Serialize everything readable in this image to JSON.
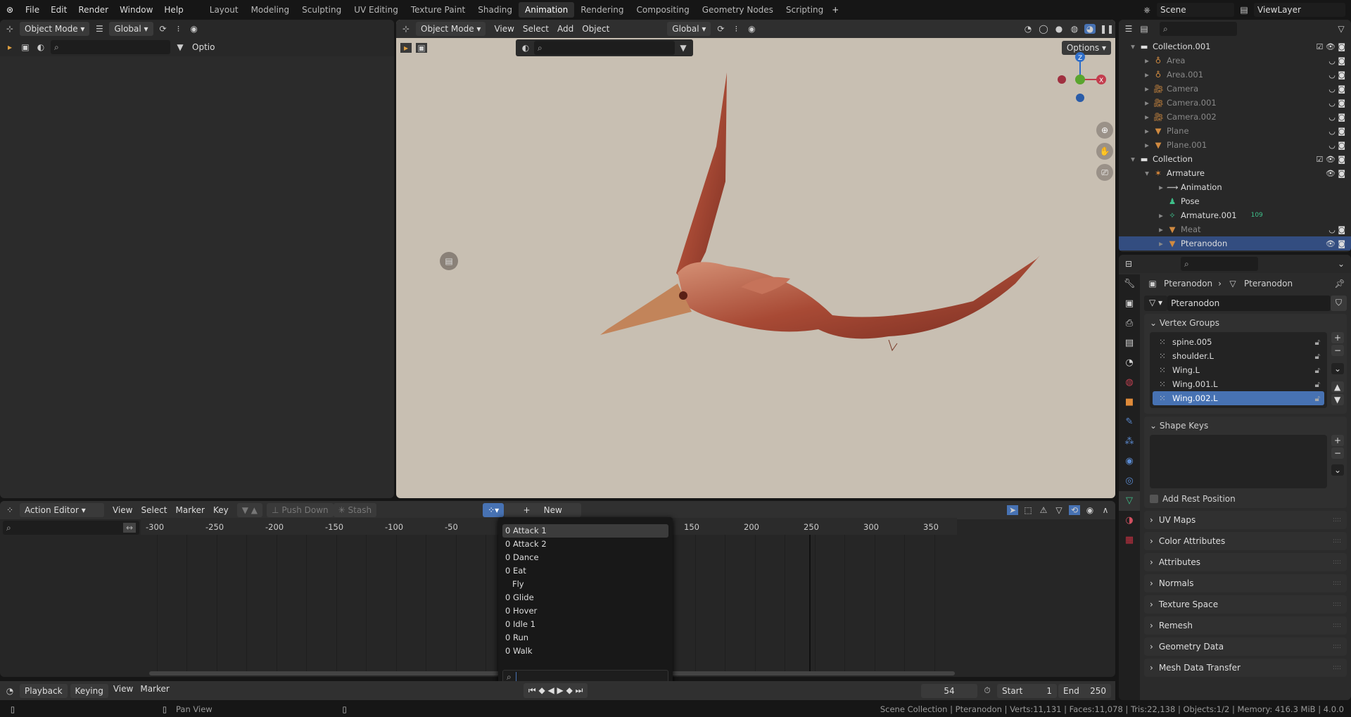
{
  "topbar": {
    "menus": [
      "File",
      "Edit",
      "Render",
      "Window",
      "Help"
    ],
    "workspaces": [
      "Layout",
      "Modeling",
      "Sculpting",
      "UV Editing",
      "Texture Paint",
      "Shading",
      "Animation",
      "Rendering",
      "Compositing",
      "Geometry Nodes",
      "Scripting"
    ],
    "active_workspace": "Animation",
    "scene": "Scene",
    "view_layer": "ViewLayer"
  },
  "left_editor": {
    "mode": "Object Mode",
    "orientation": "Global",
    "options": "Optio"
  },
  "viewport": {
    "mode": "Object Mode",
    "menus": [
      "View",
      "Select",
      "Add",
      "Object"
    ],
    "orientation": "Global",
    "options": "Options",
    "gizmo": {
      "x": "X",
      "y": "Y",
      "z": "Z"
    }
  },
  "outliner": {
    "rows": [
      {
        "name": "Collection.001",
        "depth": 0,
        "icon": "collection-icon",
        "grey": false
      },
      {
        "name": "Area",
        "depth": 1,
        "icon": "light-icon",
        "grey": true
      },
      {
        "name": "Area.001",
        "depth": 1,
        "icon": "light-icon",
        "grey": true
      },
      {
        "name": "Camera",
        "depth": 1,
        "icon": "camera-icon",
        "grey": true
      },
      {
        "name": "Camera.001",
        "depth": 1,
        "icon": "camera-icon",
        "grey": true
      },
      {
        "name": "Camera.002",
        "depth": 1,
        "icon": "camera-icon",
        "grey": true
      },
      {
        "name": "Plane",
        "depth": 1,
        "icon": "mesh-icon",
        "grey": true
      },
      {
        "name": "Plane.001",
        "depth": 1,
        "icon": "mesh-icon",
        "grey": true
      },
      {
        "name": "Collection",
        "depth": 0,
        "icon": "collection-icon",
        "grey": false
      },
      {
        "name": "Armature",
        "depth": 1,
        "icon": "armature-icon",
        "grey": false
      },
      {
        "name": "Animation",
        "depth": 2,
        "icon": "animation-icon",
        "grey": false
      },
      {
        "name": "Pose",
        "depth": 2,
        "icon": "pose-icon",
        "grey": false
      },
      {
        "name": "Armature.001",
        "depth": 2,
        "icon": "armature-data-icon",
        "grey": false,
        "badge": "109"
      },
      {
        "name": "Meat",
        "depth": 2,
        "icon": "mesh-icon",
        "grey": true
      },
      {
        "name": "Pteranodon",
        "depth": 2,
        "icon": "mesh-icon",
        "grey": false,
        "selected": true
      }
    ]
  },
  "properties": {
    "breadcrumb_object": "Pteranodon",
    "breadcrumb_data": "Pteranodon",
    "mesh_name": "Pteranodon",
    "vertex_groups_title": "Vertex Groups",
    "vertex_groups": [
      "spine.005",
      "shoulder.L",
      "Wing.L",
      "Wing.001.L",
      "Wing.002.L"
    ],
    "selected_vertex_group": "Wing.002.L",
    "shape_keys_title": "Shape Keys",
    "add_rest_position": "Add Rest Position",
    "panels": [
      "UV Maps",
      "Color Attributes",
      "Attributes",
      "Normals",
      "Texture Space",
      "Remesh",
      "Geometry Data",
      "Mesh Data Transfer"
    ]
  },
  "action_editor": {
    "mode": "Action Editor",
    "menus": [
      "View",
      "Select",
      "Marker",
      "Key"
    ],
    "push_down": "Push Down",
    "stash": "Stash",
    "new": "New",
    "ruler": [
      -300,
      -250,
      -200,
      -150,
      -100,
      -50,
      150,
      200,
      250,
      300,
      350
    ]
  },
  "action_dropdown": {
    "items": [
      "0 Attack 1",
      "0 Attack 2",
      "0 Dance",
      "0 Eat",
      "Fly",
      "0 Glide",
      "0 Hover",
      "0 Idle 1",
      "0 Run",
      "0 Walk"
    ],
    "highlighted": "0 Attack 1",
    "search_value": ""
  },
  "timeline": {
    "menus": [
      "Playback",
      "Keying",
      "View",
      "Marker"
    ],
    "current_frame": "54",
    "start_label": "Start",
    "start": "1",
    "end_label": "End",
    "end": "250"
  },
  "status": {
    "hint": "Pan View",
    "info": "Scene Collection | Pteranodon | Verts:11,131 | Faces:11,078 | Tris:22,138 | Objects:1/2 | Memory: 416.3 MiB | 4.0.0"
  },
  "colors": {
    "accent": "#4772b3",
    "viewport_bg": "#c8bfb2",
    "selected_row": "#334d80"
  }
}
